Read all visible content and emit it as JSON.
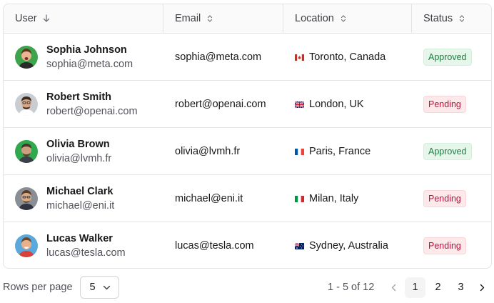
{
  "columns": {
    "user": "User",
    "email": "Email",
    "location": "Location",
    "status": "Status"
  },
  "rows": [
    {
      "name": "Sophia Johnson",
      "handle": "sophia@meta.com",
      "email": "sophia@meta.com",
      "location": "Toronto, Canada",
      "flag": "canada-flag-icon",
      "status": "Approved",
      "avatar_bg": "#3fa34d"
    },
    {
      "name": "Robert Smith",
      "handle": "robert@openai.com",
      "email": "robert@openai.com",
      "location": "London, UK",
      "flag": "uk-flag-icon",
      "status": "Pending",
      "avatar_bg": "#c9cdd2"
    },
    {
      "name": "Olivia Brown",
      "handle": "olivia@lvmh.fr",
      "email": "olivia@lvmh.fr",
      "location": "Paris, France",
      "flag": "france-flag-icon",
      "status": "Approved",
      "avatar_bg": "#2fa84f"
    },
    {
      "name": "Michael Clark",
      "handle": "michael@eni.it",
      "email": "michael@eni.it",
      "location": "Milan, Italy",
      "flag": "italy-flag-icon",
      "status": "Pending",
      "avatar_bg": "#8a8f96"
    },
    {
      "name": "Lucas Walker",
      "handle": "lucas@tesla.com",
      "email": "lucas@tesla.com",
      "location": "Sydney, Australia",
      "flag": "australia-flag-icon",
      "status": "Pending",
      "avatar_bg": "#5aa8dc"
    }
  ],
  "footer": {
    "rows_per_page_label": "Rows per page",
    "rows_per_page_value": "5",
    "range": "1 - 5 of 12",
    "pages": [
      "1",
      "2",
      "3"
    ],
    "current_page": "1"
  },
  "colors": {
    "approved_bg": "#e6f6ea",
    "approved_text": "#15803d",
    "pending_bg": "#fde8ea",
    "pending_text": "#be123c",
    "border": "#e4e4e7"
  }
}
